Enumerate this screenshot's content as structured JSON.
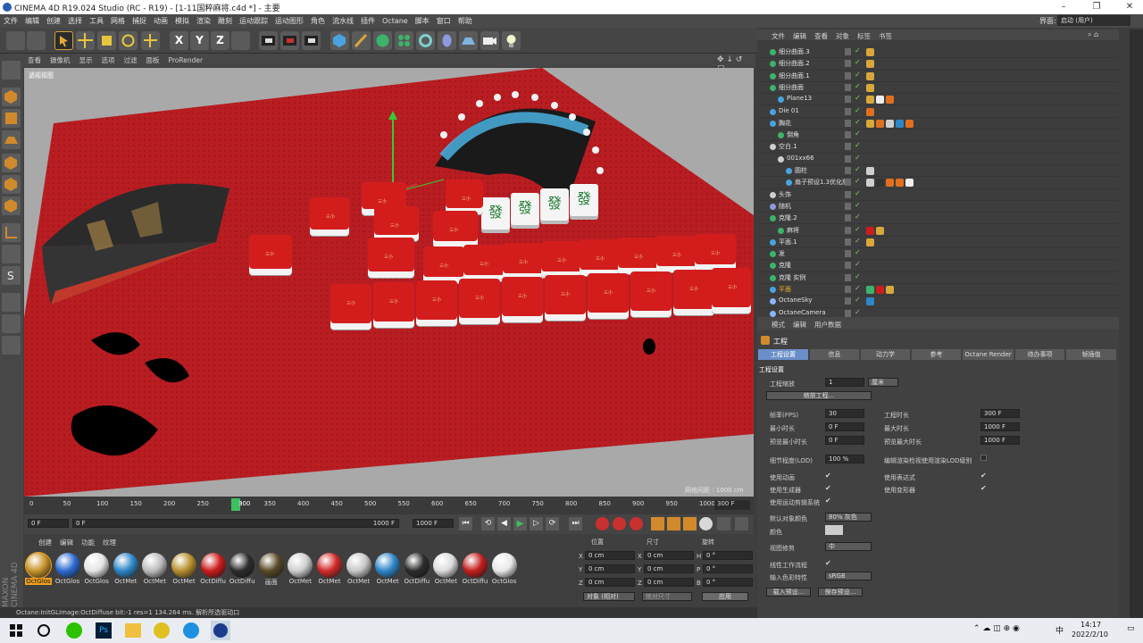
{
  "window": {
    "title": "CINEMA 4D R19.024 Studio (RC - R19) - [1-11国粹麻将.c4d *] - 主要"
  },
  "menu": [
    "文件",
    "编辑",
    "创建",
    "选择",
    "工具",
    "网格",
    "捕捉",
    "动画",
    "模拟",
    "渲染",
    "雕刻",
    "运动跟踪",
    "运动图形",
    "角色",
    "流水线",
    "插件",
    "Octane",
    "脚本",
    "窗口",
    "帮助"
  ],
  "layout": {
    "label": "界面:",
    "value": "启动 (用户)"
  },
  "viewport": {
    "menu": [
      "查看",
      "摄像机",
      "显示",
      "选项",
      "过滤",
      "面板",
      "ProRender"
    ],
    "camera_label": "透视视图",
    "grid_label": "网格间距 : 1000 cm",
    "tile_char": "三小",
    "green_char": "發"
  },
  "timeline": {
    "ticks": [
      "0",
      "50",
      "100",
      "150",
      "200",
      "250",
      "300",
      "350",
      "400",
      "450",
      "500",
      "550",
      "600",
      "650",
      "700",
      "750",
      "800",
      "850",
      "900",
      "950",
      "1000"
    ],
    "end": "300 F",
    "current": "300"
  },
  "transport": {
    "start": "0 F",
    "preview_start": "0 F",
    "preview_end": "1000 F",
    "end": "1000 F"
  },
  "materials": {
    "menu": [
      "创建",
      "编辑",
      "功能",
      "纹理"
    ],
    "items": [
      {
        "label": "OctGlos",
        "color": "#c8962c"
      },
      {
        "label": "OctGlos",
        "color": "#2e6bd1"
      },
      {
        "label": "OctGlos",
        "color": "#e4e4e4"
      },
      {
        "label": "OctMet",
        "color": "#2f86c8"
      },
      {
        "label": "OctMet",
        "color": "#bdbdbd"
      },
      {
        "label": "OctMet",
        "color": "#b8902e"
      },
      {
        "label": "OctDiffu",
        "color": "#cc1c1c"
      },
      {
        "label": "OctDiffu",
        "color": "#2d2d2d"
      },
      {
        "label": "画面",
        "color": "#5a4a2a"
      },
      {
        "label": "OctMet",
        "color": "#cfcfcf"
      },
      {
        "label": "OctMet",
        "color": "#d22a2a"
      },
      {
        "label": "OctMet",
        "color": "#c8c8c8"
      },
      {
        "label": "OctMet",
        "color": "#2f86c8"
      },
      {
        "label": "OctDiffu",
        "color": "#2d2d2d"
      },
      {
        "label": "OctMet",
        "color": "#dcdcdc"
      },
      {
        "label": "OctDiffu",
        "color": "#c41e1e"
      },
      {
        "label": "OctGlos",
        "color": "#e8e8e8"
      }
    ]
  },
  "coords": {
    "headers": [
      "位置",
      "尺寸",
      "旋转"
    ],
    "rows": [
      {
        "axis": "X",
        "pos": "0 cm",
        "size": "0 cm",
        "rot_axis": "H",
        "rot": "0 °"
      },
      {
        "axis": "Y",
        "pos": "0 cm",
        "size": "0 cm",
        "rot_axis": "P",
        "rot": "0 °"
      },
      {
        "axis": "Z",
        "pos": "0 cm",
        "size": "0 cm",
        "rot_axis": "B",
        "rot": "0 °"
      }
    ],
    "mode": "对象 (相对)",
    "size_mode": "绝对尺寸",
    "apply": "应用"
  },
  "status": "Octane:InitGLImage:OctDiffuse  bit:-1 res=1  134.264 ms.    解析所选驱动口",
  "objects": {
    "menu": [
      "文件",
      "编辑",
      "查看",
      "对象",
      "标签",
      "书签"
    ],
    "rows": [
      {
        "name": "细分曲面.3",
        "indent": 0
      },
      {
        "name": "细分曲面.2",
        "indent": 0
      },
      {
        "name": "细分曲面.1",
        "indent": 0
      },
      {
        "name": "细分曲面",
        "indent": 0
      },
      {
        "name": "Plane13",
        "indent": 1
      },
      {
        "name": "Die 01",
        "indent": 0
      },
      {
        "name": "胸花",
        "indent": 0
      },
      {
        "name": "倒角",
        "indent": 1
      },
      {
        "name": "空白.1",
        "indent": 0
      },
      {
        "name": "001xx66",
        "indent": 1
      },
      {
        "name": "圆柱",
        "indent": 2
      },
      {
        "name": "扇子预设1.3优化版",
        "indent": 2
      },
      {
        "name": "头饰",
        "indent": 0
      },
      {
        "name": "随机",
        "indent": 0
      },
      {
        "name": "克隆.2",
        "indent": 0
      },
      {
        "name": "麻将",
        "indent": 1
      },
      {
        "name": "平面.1",
        "indent": 0
      },
      {
        "name": "发",
        "indent": 0
      },
      {
        "name": "克隆",
        "indent": 0
      },
      {
        "name": "克隆 实例",
        "indent": 0
      },
      {
        "name": "平面",
        "indent": 0
      },
      {
        "name": "OctaneSky",
        "indent": 0
      },
      {
        "name": "OctaneCamera",
        "indent": 0
      }
    ]
  },
  "attributes": {
    "menu": [
      "模式",
      "编辑",
      "用户数据"
    ],
    "title": "工程",
    "tabs": [
      "工程设置",
      "信息",
      "动力学",
      "参考",
      "Octane Render",
      "待办事项",
      "帧插值"
    ],
    "section": "工程设置",
    "scale_label": "工程缩放",
    "scale_value": "1",
    "scale_unit": "厘米",
    "scale_button": "缩放工程...",
    "fps_label": "帧率(FPS)",
    "fps": "30",
    "duration_label": "工程时长",
    "duration": "300 F",
    "min_label": "最小时长",
    "min": "0 F",
    "max_label": "最大时长",
    "max": "1000 F",
    "pmin_label": "预览最小时长",
    "pmin": "0 F",
    "pmax_label": "预览最大时长",
    "pmax": "1000 F",
    "lod_label": "细节程度(LOD)",
    "lod": "100 %",
    "lod_render_label": "编辑渲染检视使用渲染LOD级别",
    "anim_label": "使用动画",
    "expr_label": "使用表达式",
    "gen_label": "使用生成器",
    "deform_label": "使用变形器",
    "mograph_label": "使用运动剪辑系统",
    "objcolor_label": "默认对象颜色",
    "objcolor": "80% 灰色",
    "color_label": "颜色",
    "clip_label": "视图修剪",
    "clip": "中",
    "linear_label": "线性工作流程",
    "inputcolor_label": "输入色彩特性",
    "inputcolor": "sRGB",
    "load_preset": "载入预设...",
    "save_preset": "保存预设..."
  },
  "taskbar": {
    "time": "14:17",
    "date": "2022/2/10",
    "ime": "中"
  }
}
